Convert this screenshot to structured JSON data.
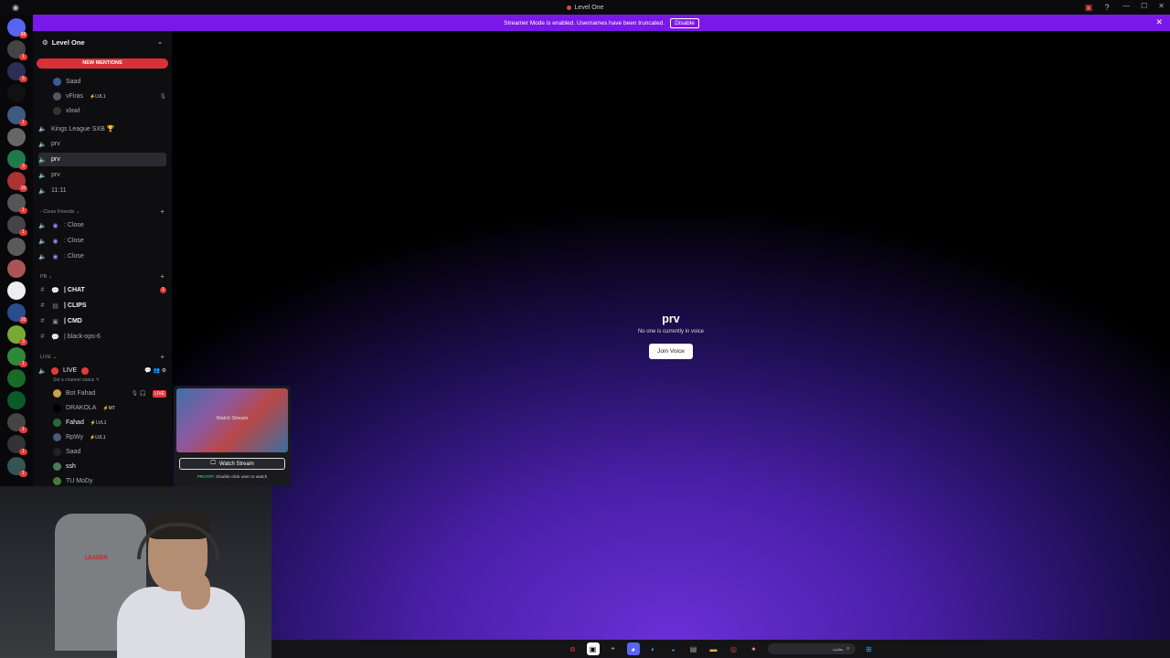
{
  "window": {
    "title": "Level One"
  },
  "banner": {
    "text": "Streamer Mode is enabled. Usernames have been truncated.",
    "disable_label": "Disable"
  },
  "server": {
    "name": "Level One"
  },
  "sidebar": {
    "new_mentions": "NEW MENTIONS",
    "voice_users_top": [
      {
        "name": "Saad",
        "tag": ""
      },
      {
        "name": "vFiras",
        "tag": "⚡LVL1"
      },
      {
        "name": "xlxwl",
        "tag": ""
      }
    ],
    "channels_top": [
      {
        "name": "Kings League SXB 🏆"
      },
      {
        "name": "prv"
      },
      {
        "name": "prv"
      },
      {
        "name": "prv"
      },
      {
        "name": "11:11"
      }
    ],
    "category_close_friends": "- Close Friends ⌄",
    "close_friends": [
      {
        "name": ": Close"
      },
      {
        "name": ": Close"
      },
      {
        "name": ": Close"
      }
    ],
    "category_pb": "PB ⌄",
    "pb_channels": [
      {
        "name": "| CHAT",
        "badge": "1"
      },
      {
        "name": "| CLIPS"
      },
      {
        "name": "| CMD"
      },
      {
        "name": "| black-ops-6"
      }
    ],
    "category_live": "LIVE ⌄",
    "live_channel": {
      "name": "LIVE",
      "status": "Set a channel status ✎"
    },
    "live_users": [
      {
        "name": "Bot Fahad",
        "tag": "",
        "live": "LIVE"
      },
      {
        "name": "DRAKOLA",
        "tag": "⚡MT"
      },
      {
        "name": "Fahad",
        "tag": "⚡LVL1"
      },
      {
        "name": "RpWy",
        "tag": "⚡LVL1"
      },
      {
        "name": "Saad",
        "tag": ""
      },
      {
        "name": "ssh",
        "tag": ""
      },
      {
        "name": "TU MoDy",
        "tag": ""
      }
    ]
  },
  "preview": {
    "overlay_text": "Watch Stream",
    "watch_label": "Watch Stream",
    "protip_label": "PROTIP:",
    "protip_text": "Double click user to watch"
  },
  "main": {
    "channel_title": "prv",
    "subtitle": "No one is currently in voice",
    "join_label": "Join Voice"
  },
  "webcam": {
    "chair_text": "LEADER"
  },
  "taskbar": {
    "search_text": "بحث"
  },
  "colors": {
    "banner": "#7a18e8",
    "mention": "#d9313a",
    "live": "#e23b3b"
  }
}
